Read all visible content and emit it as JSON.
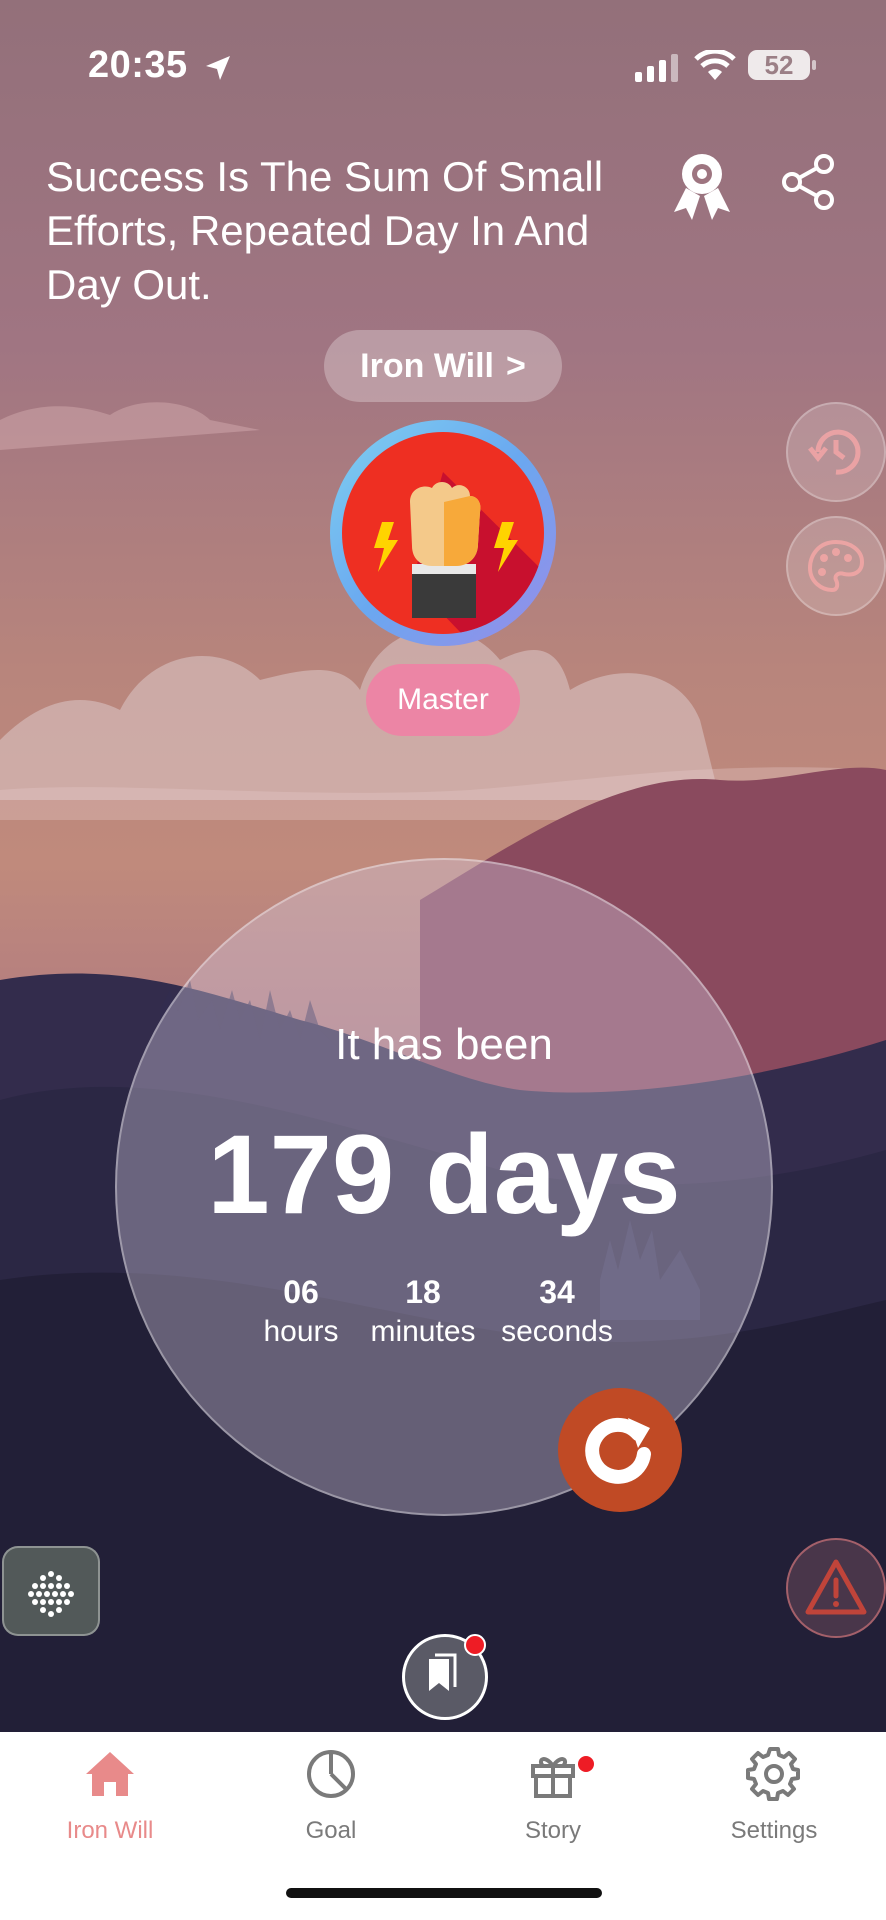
{
  "status_bar": {
    "time": "20:35",
    "battery": "52"
  },
  "header": {
    "quote": "Success Is The Sum Of Small Efforts, Repeated Day In And Day Out."
  },
  "challenge_pill": {
    "label": "Iron Will",
    "chevron": ">"
  },
  "level_badge": {
    "label": "Master"
  },
  "timer": {
    "intro": "It has been",
    "days": "179 days",
    "hours_value": "06",
    "hours_label": "hours",
    "minutes_value": "18",
    "minutes_label": "minutes",
    "seconds_value": "34",
    "seconds_label": "seconds"
  },
  "tabs": [
    {
      "label": "Iron Will",
      "icon": "home-icon",
      "active": true
    },
    {
      "label": "Goal",
      "icon": "pie-chart-icon",
      "active": false
    },
    {
      "label": "Story",
      "icon": "gift-icon",
      "active": false
    },
    {
      "label": "Settings",
      "icon": "gear-icon",
      "active": false
    }
  ],
  "colors": {
    "accent_active": "#e88a8a",
    "reset_button": "#c04a25",
    "level_badge": "#ec85a5",
    "notification_dot": "#ee1c25"
  }
}
